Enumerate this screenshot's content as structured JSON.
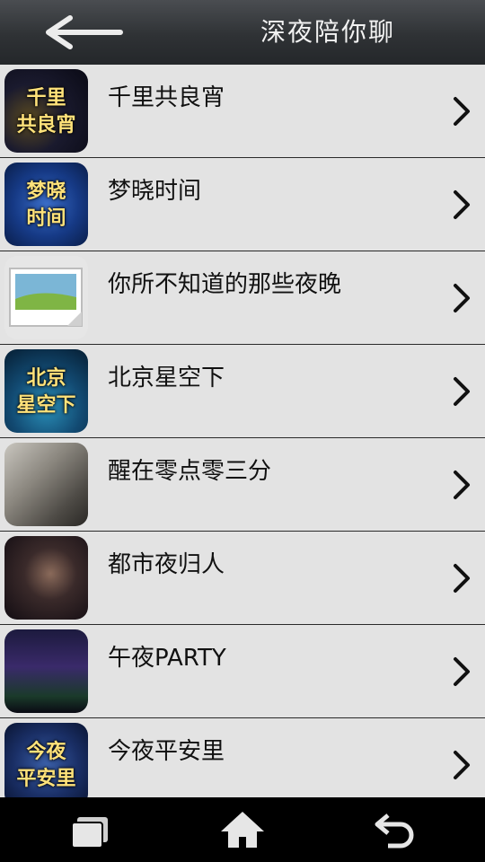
{
  "header": {
    "title": "深夜陪你聊",
    "back_icon": "back-arrow-icon"
  },
  "list": {
    "items": [
      {
        "label": "千里共良宵",
        "thumb_text": "千里\n共良宵",
        "thumb": "qianli"
      },
      {
        "label": "梦晓时间",
        "thumb_text": "梦晓\n时间",
        "thumb": "menghiao"
      },
      {
        "label": "你所不知道的那些夜晚",
        "thumb_text": "",
        "thumb": "placeholder"
      },
      {
        "label": "北京星空下",
        "thumb_text": "北京\n星空下",
        "thumb": "beijing"
      },
      {
        "label": "醒在零点零三分",
        "thumb_text": "",
        "thumb": "cat"
      },
      {
        "label": "都市夜归人",
        "thumb_text": "",
        "thumb": "city"
      },
      {
        "label": "午夜PARTY",
        "thumb_text": "",
        "thumb": "party"
      },
      {
        "label": "今夜平安里",
        "thumb_text": "今夜\n平安里",
        "thumb": "jinye"
      }
    ],
    "chevron_icon": "chevron-right-icon"
  },
  "navbar": {
    "recent_icon": "recent-apps-icon",
    "home_icon": "home-icon",
    "back_icon": "back-icon"
  },
  "colors": {
    "titlebar": "#2f3235",
    "row_background": "#e3e3e3",
    "row_divider": "#2a2a2a",
    "navbar": "#000000"
  }
}
